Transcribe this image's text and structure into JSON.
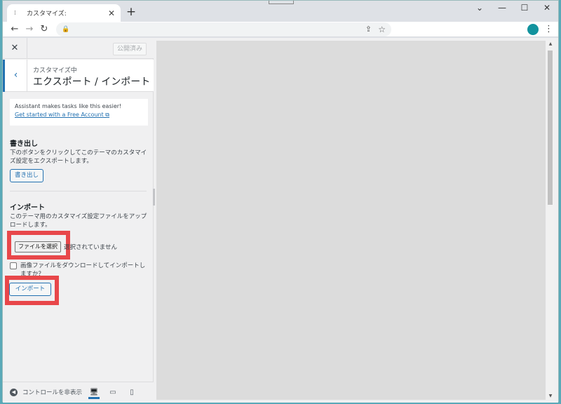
{
  "browser": {
    "tab_title": "カスタマイズ:",
    "tab_close": "✕",
    "new_tab": "+",
    "win_minimize": "⌄",
    "win_min": "—",
    "win_max": "☐",
    "win_close": "✕",
    "back": "←",
    "forward": "→",
    "reload": "↻",
    "lock": "🔒",
    "share": "⇪",
    "star": "☆",
    "menu": "⋮",
    "profile_color": "#12939e"
  },
  "customizer": {
    "close": "✕",
    "publish_label": "公開済み",
    "back_icon": "‹",
    "panel_subtitle": "カスタマイズ中",
    "panel_title": "エクスポート / インポート",
    "notice_text": "Assistant makes tasks like this easier!",
    "notice_link": "Get started with a Free Account ⧉",
    "export": {
      "title": "書き出し",
      "description": "下のボタンをクリックしてこのテーマのカスタマイズ設定をエクスポートします。",
      "button_label": "書き出し"
    },
    "import": {
      "title": "インポート",
      "description": "このテーマ用のカスタマイズ設定ファイルをアップロードします。",
      "file_button_label": "ファイルを選択",
      "file_status": "選択されていません",
      "checkbox_label": "画像ファイルをダウンロードしてインポートしますか？",
      "button_label": "インポート"
    },
    "footer": {
      "collapse_icon": "◀",
      "collapse_label": "コントロールを非表示",
      "device_desktop": "🖥",
      "device_tablet": "▭",
      "device_mobile": "▯"
    }
  },
  "colors": {
    "accent": "#2271b1",
    "highlight": "#e8474a"
  }
}
